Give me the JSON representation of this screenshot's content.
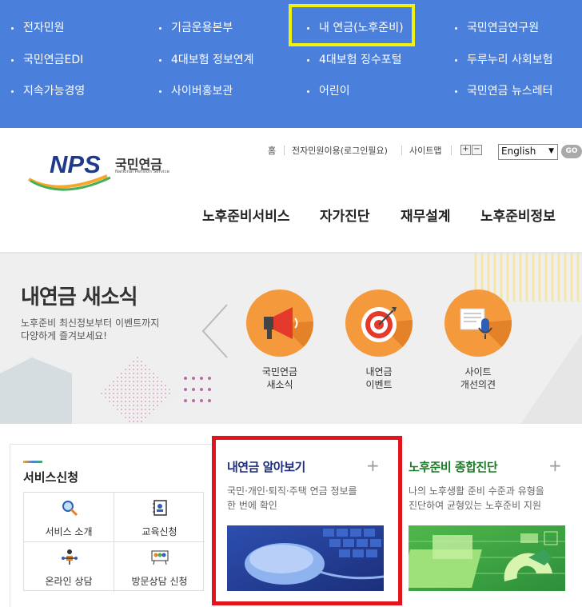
{
  "top_menu": {
    "items": [
      {
        "label": "전자민원"
      },
      {
        "label": "기금운용본부"
      },
      {
        "label": "내 연금(노후준비)"
      },
      {
        "label": "국민연금연구원"
      },
      {
        "label": "국민연금EDI"
      },
      {
        "label": "4대보험 정보연계"
      },
      {
        "label": "4대보험 징수포털"
      },
      {
        "label": "두루누리 사회보험"
      },
      {
        "label": "지속가능경영"
      },
      {
        "label": "사이버홍보관"
      },
      {
        "label": "어린이"
      },
      {
        "label": "국민연금 뉴스레터"
      }
    ]
  },
  "header": {
    "logo_text": "NPS",
    "logo_korean": "국민연금",
    "logo_english": "National Pension Service",
    "utility": {
      "home": "홈",
      "civil_service": "전자민원이용(로그인필요)",
      "sitemap": "사이트맵",
      "zoom_in": "+",
      "zoom_out": "−"
    },
    "language": {
      "selected": "English",
      "go": "GO"
    },
    "gnb": [
      "노후준비서비스",
      "자가진단",
      "재무설계",
      "노후준비정보"
    ]
  },
  "banner": {
    "title": "내연금 새소식",
    "desc_line1": "노후준비 최신정보부터 이벤트까지",
    "desc_line2": "다양하게 즐겨보세요!",
    "items": [
      {
        "line1": "국민연금",
        "line2": "새소식",
        "icon": "megaphone-icon"
      },
      {
        "line1": "내연금",
        "line2": "이벤트",
        "icon": "target-icon"
      },
      {
        "line1": "사이트",
        "line2": "개선의견",
        "icon": "microphone-icon"
      }
    ]
  },
  "services": {
    "title": "서비스신청",
    "items": [
      {
        "label": "서비스 소개",
        "icon": "magnifier-icon"
      },
      {
        "label": "교육신청",
        "icon": "contact-book-icon"
      },
      {
        "label": "온라인 상담",
        "icon": "network-icon"
      },
      {
        "label": "방문상담 신청",
        "icon": "group-people-icon"
      }
    ]
  },
  "cards": [
    {
      "title": "내연금 알아보기",
      "desc_line1": "국민·개인·퇴직·주택 연금 정보를",
      "desc_line2": "한 번에 확인",
      "plus": "+",
      "title_color": "#1d2c7a"
    },
    {
      "title": "노후준비 종합진단",
      "desc_line1": "나의 노후생활 준비 수준과 유형을",
      "desc_line2": "진단하여 균형있는 노후준비 지원",
      "plus": "+",
      "title_color": "#1e7a2a"
    }
  ],
  "colors": {
    "top_menu_bg": "#4a7fdc",
    "highlight_yellow": "#f2f20a",
    "highlight_red": "#e0151f",
    "accent_orange": "#f59a3c",
    "logo_blue": "#1e3a8a"
  }
}
